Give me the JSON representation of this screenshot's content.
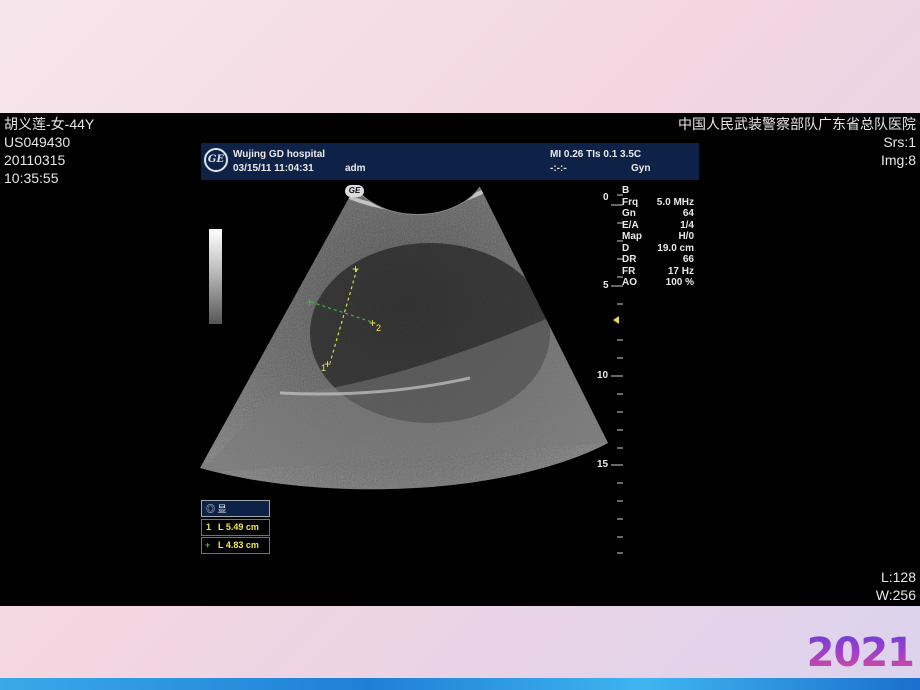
{
  "slide": {
    "year": "2021"
  },
  "overlay": {
    "top_left": [
      "胡义莲-女-44Y",
      "US049430",
      "20110315",
      "10:35:55"
    ],
    "top_right": [
      "中国人民武装警察部队广东省总队医院",
      "Srs:1",
      "Img:8"
    ],
    "bottom_right": [
      "L:128",
      "W:256"
    ]
  },
  "ultrasound": {
    "header": {
      "logo_text": "GE",
      "hospital": "Wujing GD hospital",
      "datetime": "03/15/11 11:04:31",
      "operator": "adm",
      "mi_tis": "MI 0.26 TIs 0.1 3.5C",
      "placeholder": "-:-:-",
      "preset": "Gyn"
    },
    "ge_mark": "GE",
    "params": [
      {
        "label": "B",
        "value": ""
      },
      {
        "label": "Frq",
        "value": "5.0 MHz"
      },
      {
        "label": "Gn",
        "value": "64"
      },
      {
        "label": "E/A",
        "value": "1/4"
      },
      {
        "label": "Map",
        "value": "H/0"
      },
      {
        "label": "D",
        "value": "19.0 cm"
      },
      {
        "label": "DR",
        "value": "66"
      },
      {
        "label": "FR",
        "value": "17 Hz"
      },
      {
        "label": "AO",
        "value": "100 %"
      }
    ],
    "depth_labels": [
      "0",
      "5",
      "10",
      "15"
    ],
    "measurements": {
      "header_text": "◎ 显",
      "rows": [
        {
          "marker": "1",
          "text": "L  5.49 cm",
          "color": "#f2e84a"
        },
        {
          "marker": "+",
          "text": "L  4.83 cm",
          "color": "#f2e84a"
        }
      ]
    },
    "calipers": [
      "1",
      "2"
    ]
  }
}
